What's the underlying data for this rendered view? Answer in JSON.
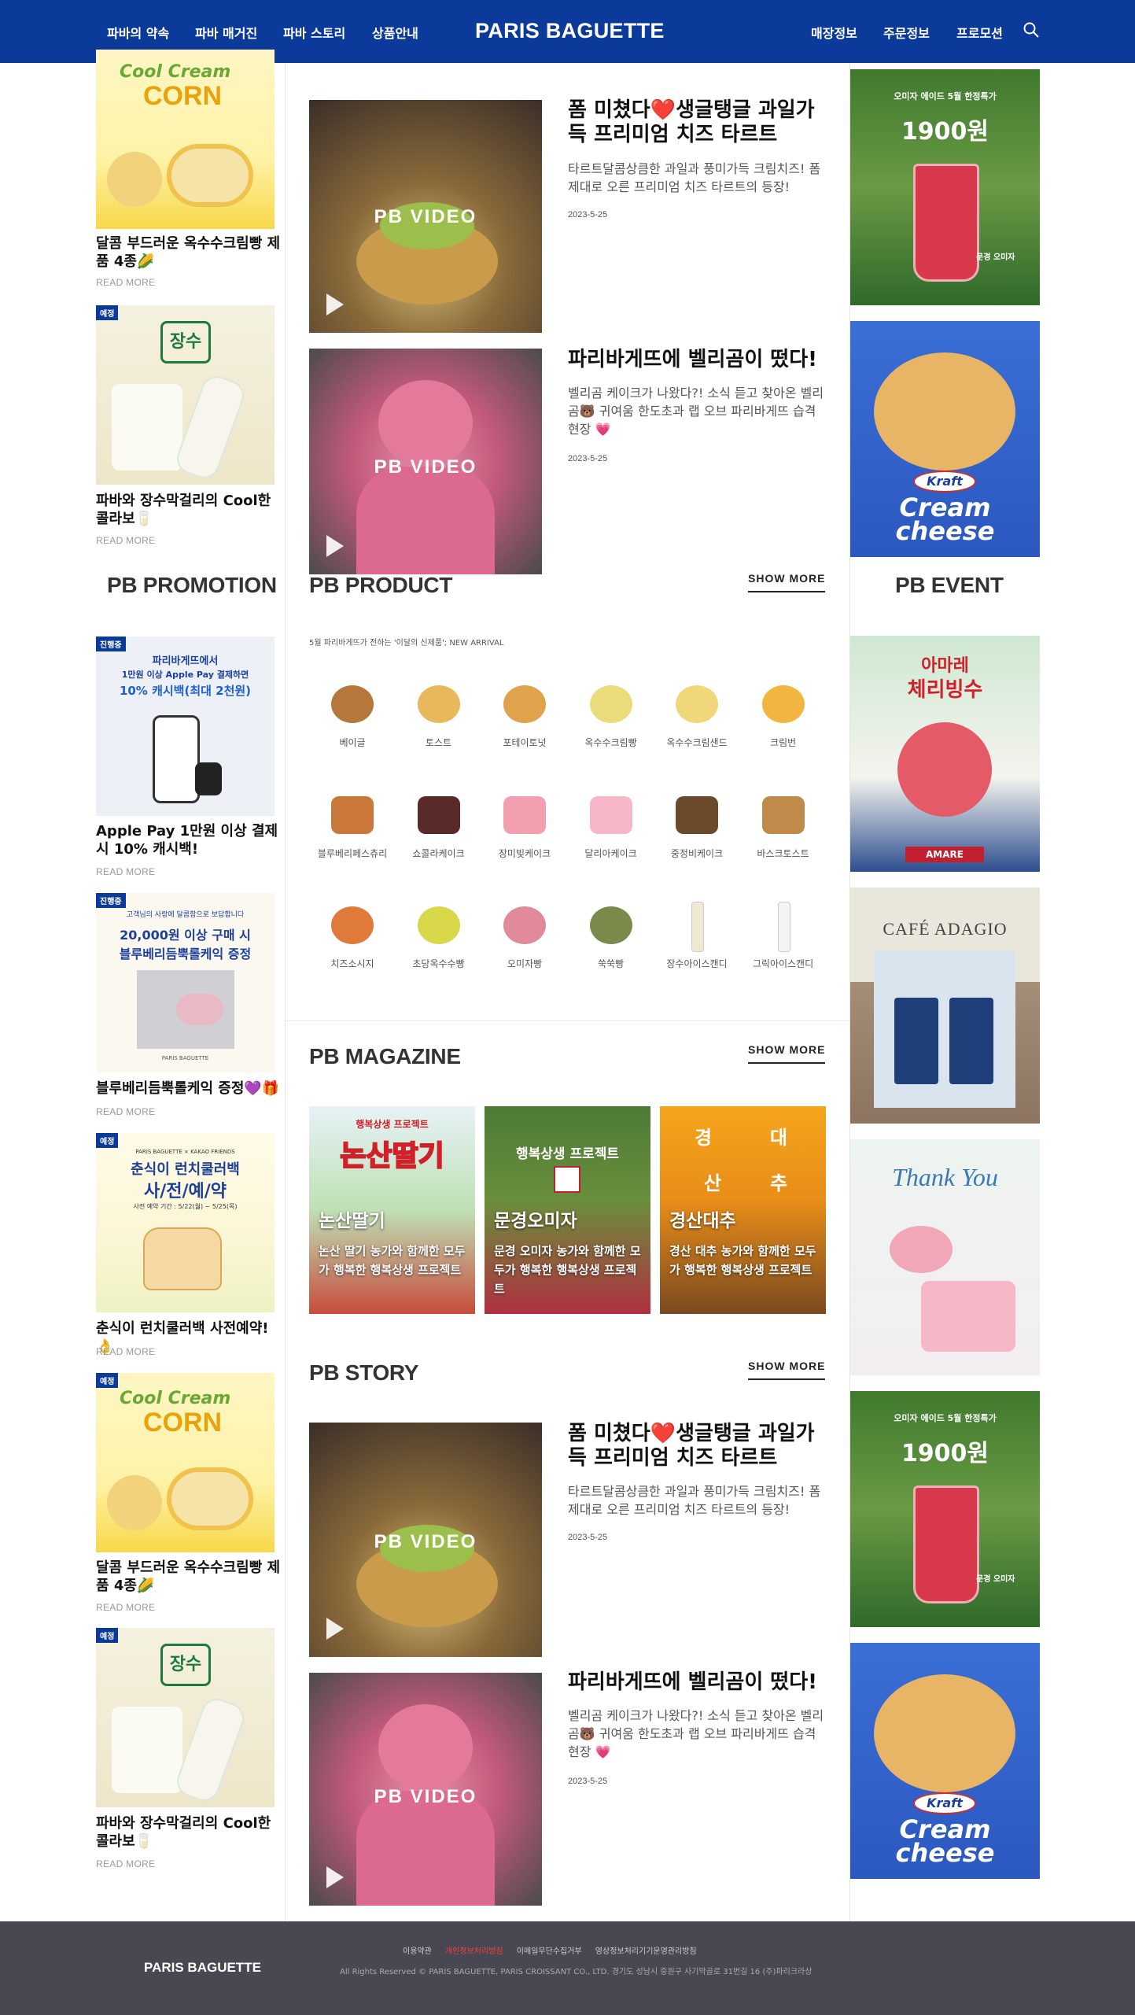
{
  "header": {
    "nav_left": [
      "파바의 약속",
      "파바 매거진",
      "파바 스토리",
      "상품안내"
    ],
    "brand": "PARIS BAGUETTE",
    "nav_right": [
      "매장정보",
      "주문정보",
      "프로모션"
    ],
    "search_icon": "search-icon",
    "bg_color": "#0b3a9a"
  },
  "left_column": {
    "top_cards": [
      {
        "tag": "",
        "title": "달콤 부드러운 옥수수크림빵 제품 4종🌽",
        "more": "READ MORE",
        "image_text": [
          "Cool Cream",
          "CORN"
        ]
      },
      {
        "tag": "예정",
        "title": "파바와 장수막걸리의 Cool한 콜라보🥛",
        "more": "READ MORE",
        "image_text": [
          "장수"
        ]
      }
    ],
    "promotion_heading": "PB PROMOTION",
    "promo_cards": [
      {
        "tag": "진행중",
        "title": "Apple Pay 1만원 이상 결제 시 10% 캐시백!",
        "more": "READ MORE",
        "image_text": [
          "파리바게뜨에서",
          "1만원 이상 Apple Pay 결제하면",
          "10% 캐시백(최대 2천원)"
        ]
      },
      {
        "tag": "진행중",
        "title": "블루베리듬뿍롤케익 증정💜🎁",
        "more": "READ MORE",
        "image_text": [
          "고객님의 사랑에 달콤함으로 보답합니다",
          "20,000원 이상 구매 시",
          "블루베리듬뿍롤케익 증정",
          "PARIS BAGUETTE"
        ]
      },
      {
        "tag": "예정",
        "title": "춘식이 런치쿨러백 사전예약!👌",
        "more": "READ MORE",
        "image_text": [
          "PARIS BAGUETTE × KAKAO FRIENDS",
          "춘식이 런치쿨러백",
          "사/전/예/약",
          "사전 예약 기간 : 5/22(월) ~ 5/25(목)"
        ]
      },
      {
        "tag": "예정",
        "title": "달콤 부드러운 옥수수크림빵 제품 4종🌽",
        "more": "READ MORE",
        "image_text": [
          "Cool Cream",
          "CORN"
        ]
      },
      {
        "tag": "예정",
        "title": "파바와 장수막걸리의 Cool한 콜라보🥛",
        "more": "READ MORE",
        "image_text": [
          "장수"
        ]
      }
    ]
  },
  "stories_top": [
    {
      "badge": "PB VIDEO",
      "title": "폼 미쳤다❤️생글탱글 과일가득 프리미엄 치즈 타르트",
      "desc": "타르트달콤상큼한 과일과 풍미가득 크림치즈! 폼 제대로 오른 프리미엄 치즈 타르트의 등장!",
      "date": "2023-5-25"
    },
    {
      "badge": "PB VIDEO",
      "title": "파리바게뜨에 벨리곰이 떴다!",
      "desc": "벨리곰 케이크가 나왔다?! 소식 듣고 찾아온 벨리곰🐻 귀여움 한도초과 랩 오브 파리바게뜨 습격 현장 💗",
      "date": "2023-5-25"
    }
  ],
  "product_section": {
    "heading": "PB PRODUCT",
    "show_more": "SHOW MORE",
    "subtitle": "5월 파리바게뜨가 전하는 '이달의 신제품'; NEW ARRIVAL",
    "items": [
      "베이글",
      "토스트",
      "포테이토넛",
      "옥수수크림빵",
      "옥수수크림샌드",
      "크림번",
      "블루베리페스츄리",
      "쇼콜라케이크",
      "장미빛케이크",
      "달리아케이크",
      "중정비케이크",
      "바스크토스트",
      "치즈소시지",
      "초당옥수수빵",
      "오미자빵",
      "쑥쑥빵",
      "장수아이스캔디",
      "그릭아이스캔디"
    ]
  },
  "magazine_section": {
    "heading": "PB MAGAZINE",
    "show_more": "SHOW MORE",
    "items": [
      {
        "title": "논산딸기",
        "desc": "논산 딸기 농가와 함께한 모두가 행복한 행복상생 프로젝트",
        "image_text": [
          "행복상생 프로젝트",
          "논산딸기"
        ]
      },
      {
        "title": "문경오미자",
        "desc": "문경 오미자 농가와 함께한 모두가 행복한 행복상생 프로젝트",
        "image_text": [
          "행복상생 프로젝트"
        ]
      },
      {
        "title": "경산대추",
        "desc": "경산 대추 농가와 함께한 모두가 행복한 행복상생 프로젝트",
        "image_text": [
          "경",
          "대",
          "산",
          "추"
        ]
      }
    ]
  },
  "story_section": {
    "heading": "PB STORY",
    "show_more": "SHOW MORE",
    "items": [
      {
        "badge": "PB VIDEO",
        "title": "폼 미쳤다❤️생글탱글 과일가득 프리미엄 치즈 타르트",
        "desc": "타르트달콤상큼한 과일과 풍미가득 크림치즈! 폼 제대로 오른 프리미엄 치즈 타르트의 등장!",
        "date": "2023-5-25"
      },
      {
        "badge": "PB VIDEO",
        "title": "파리바게뜨에 벨리곰이 떴다!",
        "desc": "벨리곰 케이크가 나왔다?! 소식 듣고 찾아온 벨리곰🐻 귀여움 한도초과 랩 오브 파리바게뜨 습격 현장 💗",
        "date": "2023-5-25"
      }
    ]
  },
  "right_column": {
    "event_heading": "PB EVENT",
    "ads": [
      {
        "text": [
          "오미자 에이드 5월 한정특가",
          "1900원",
          "문경 오미자"
        ]
      },
      {
        "text": [
          "Kraft",
          "Cream",
          "cheese"
        ]
      },
      {
        "text": [
          "아마레",
          "체리빙수",
          "AMARE"
        ]
      },
      {
        "text": [
          "CAFÉ ADAGIO"
        ]
      },
      {
        "text": [
          "Thank You"
        ]
      },
      {
        "text": [
          "오미자 에이드 5월 한정특가",
          "1900원",
          "문경 오미자"
        ]
      },
      {
        "text": [
          "Kraft",
          "Cream",
          "cheese"
        ]
      }
    ]
  },
  "footer": {
    "brand": "PARIS BAGUETTE",
    "links": [
      "이용약관",
      "개인정보처리방침",
      "이메일무단수집거부",
      "영상정보처리기기운영관리방침"
    ],
    "highlight_color": "#ff3b3b",
    "copyright": "All Rights Reserved © PARIS BAGUETTE, PARIS CROISSANT CO., LTD. 경기도 성남시 중원구 사기막골로 31번길 16 (주)파리크라상"
  }
}
